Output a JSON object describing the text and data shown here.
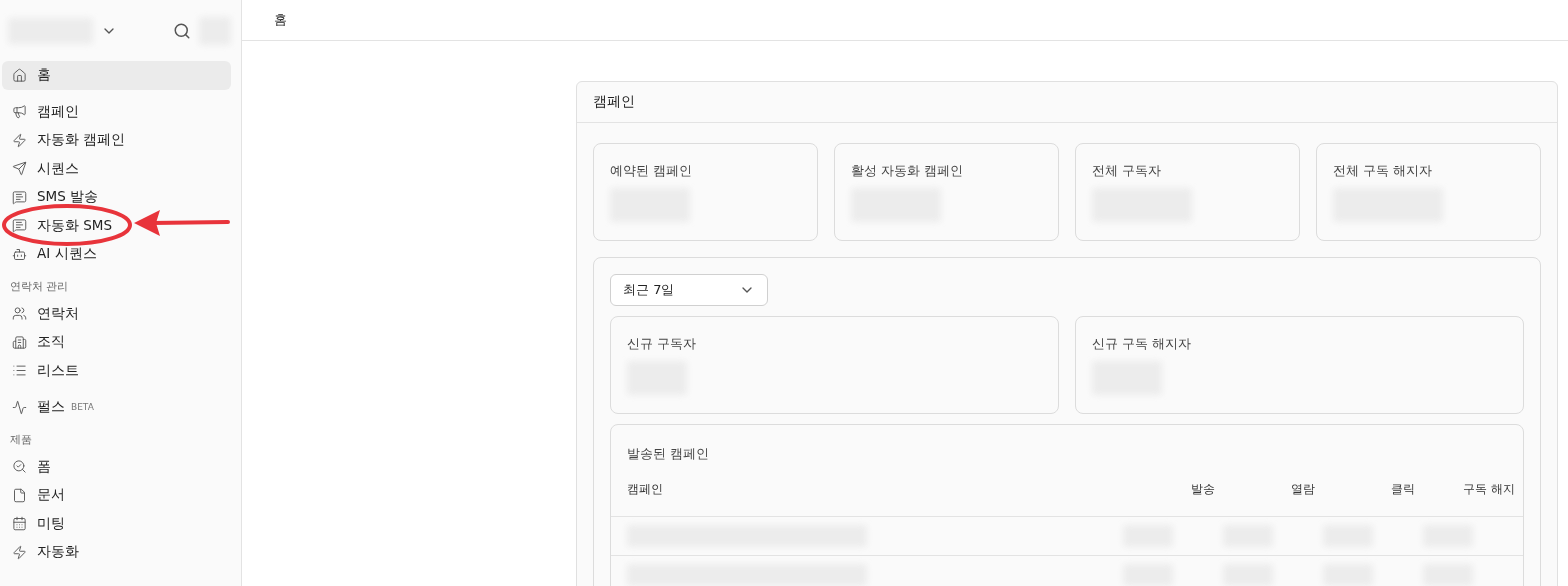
{
  "sidebar": {
    "items": [
      {
        "kind": "item",
        "label": "홈",
        "selected": true
      },
      {
        "kind": "gap"
      },
      {
        "kind": "item",
        "label": "캠페인",
        "selected": false
      },
      {
        "kind": "item",
        "label": "자동화 캠페인",
        "selected": false
      },
      {
        "kind": "item",
        "label": "시퀀스",
        "selected": false
      },
      {
        "kind": "item",
        "label": "SMS 발송",
        "selected": false
      },
      {
        "kind": "item",
        "label": "자동화 SMS",
        "selected": false
      },
      {
        "kind": "item",
        "label": "AI 시퀀스",
        "selected": false
      },
      {
        "kind": "section",
        "label": "연락처 관리"
      },
      {
        "kind": "item",
        "label": "연락처",
        "selected": false
      },
      {
        "kind": "item",
        "label": "조직",
        "selected": false
      },
      {
        "kind": "item",
        "label": "리스트",
        "selected": false
      },
      {
        "kind": "gap"
      },
      {
        "kind": "item",
        "label": "펄스",
        "badge": "BETA",
        "selected": false
      },
      {
        "kind": "section",
        "label": "제품"
      },
      {
        "kind": "item",
        "label": "폼",
        "selected": false
      },
      {
        "kind": "item",
        "label": "문서",
        "selected": false
      },
      {
        "kind": "item",
        "label": "미팅",
        "selected": false
      },
      {
        "kind": "item",
        "label": "자동화",
        "selected": false
      }
    ]
  },
  "breadcrumb": "홈",
  "panel": {
    "title": "캠페인",
    "stats": [
      "예약된 캠페인",
      "활성 자동화 캠페인",
      "전체 구독자",
      "전체 구독 해지자"
    ],
    "period": {
      "value": "최근 7일"
    },
    "period_stats": [
      "신규 구독자",
      "신규 구독 해지자"
    ],
    "sent": {
      "title": "발송된 캠페인",
      "columns": [
        "캠페인",
        "발송",
        "열람",
        "클릭",
        "구독 해지"
      ]
    }
  }
}
